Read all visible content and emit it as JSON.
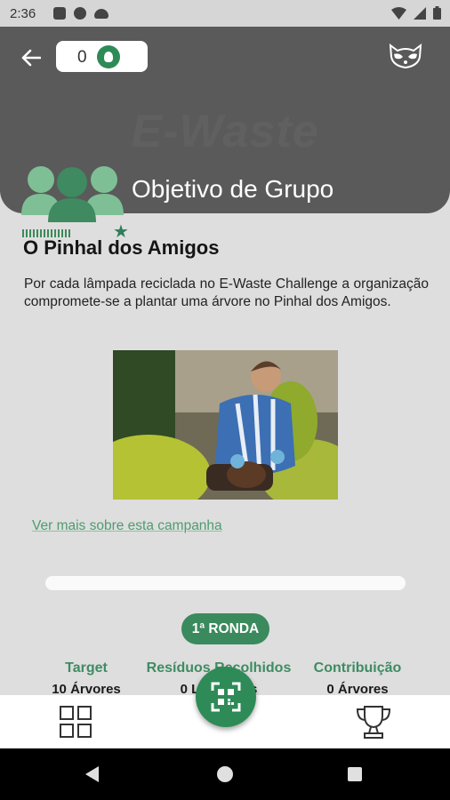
{
  "status_bar": {
    "time": "2:36",
    "icons": [
      "sim-icon",
      "messenger-icon",
      "cloud-icon",
      "wifi-icon",
      "signal-icon",
      "battery-icon"
    ]
  },
  "header": {
    "counter_value": "0",
    "counter_icon": "leaf-icon",
    "watermark": "E-Waste",
    "title": "Objetivo de Grupo",
    "avatar_icon": "group-icon",
    "profile_icon": "raccoon-icon"
  },
  "campaign": {
    "title": "O Pinhal dos Amigos",
    "description": "Por cada lâmpada reciclada no E-Waste Challenge a organização compromete-se a plantar uma árvore no Pinhal dos Amigos.",
    "image_icon": "gardener-photo",
    "more_link": "Ver mais sobre esta campanha"
  },
  "progress": {
    "value": 0
  },
  "round": {
    "label": "1ª RONDA"
  },
  "stats": [
    {
      "label": "Target",
      "value": "10 Árvores"
    },
    {
      "label": "Resíduos Recolhidos",
      "value": "0 Lâmpadas"
    },
    {
      "label": "Contribuição",
      "value": "0 Árvores"
    }
  ],
  "bottom_nav": {
    "items": [
      "dashboard-icon",
      "qr-scan-icon",
      "trophy-icon"
    ]
  },
  "colors": {
    "accent": "#2e8b57",
    "header_bg": "#5a5a5a",
    "page_bg": "#dedede"
  }
}
